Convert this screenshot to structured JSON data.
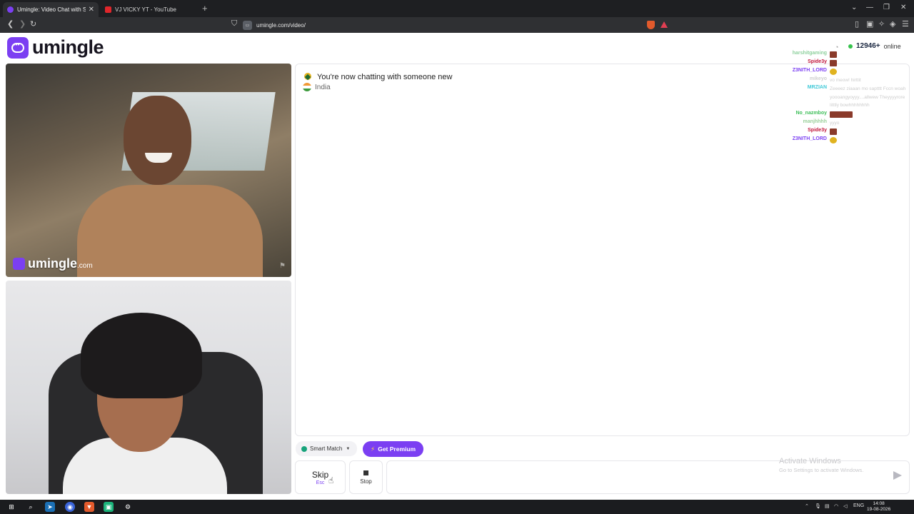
{
  "browser": {
    "tabs": [
      {
        "title": "Umingle: Video Chat with Str",
        "active": true,
        "favicon_color": "#7b3ff2"
      },
      {
        "title": "VJ VICKY YT - YouTube",
        "active": false,
        "favicon_color": "#ff0000"
      }
    ],
    "url": "umingle.com/video/"
  },
  "header": {
    "logo_text": "umingle",
    "online_count": "12946+",
    "online_label": "online"
  },
  "stranger_video": {
    "watermark_name": "umingle",
    "watermark_suffix": ".com"
  },
  "chat": {
    "status_message": "You're now chatting with someone new",
    "country": "India",
    "feed": [
      {
        "name": "harshitgaming",
        "color": "#8fd19e",
        "text": "",
        "thumb": "#8a3a2a"
      },
      {
        "name": "Spide3y",
        "color": "#c0153a",
        "text": "",
        "thumb": "#8a3a2a"
      },
      {
        "name": "Z3NITH_LORD",
        "color": "#7b3ff2",
        "text": "",
        "thumb": "#e0b320"
      },
      {
        "name": "mikeyo",
        "color": "#cfcfcf",
        "text": "vo meow! hirttit",
        "thumb": ""
      },
      {
        "name": "MRZIAN",
        "color": "#3fc9d8",
        "text": "Zeeeez ziaaan mo saptttt Fccn woah yoooangyoyyy....allwew Theyyyyrore litttly bowhhhhhhhh",
        "thumb": "",
        "tall": true
      },
      {
        "name": "No_nazmboy",
        "color": "#3fbf5a",
        "text": "",
        "thumb": "#8a3a2a",
        "wide": true
      },
      {
        "name": "manjhhhh",
        "color": "#9bd09b",
        "text": "yyyo",
        "thumb": ""
      },
      {
        "name": "Spide3y",
        "color": "#c0153a",
        "text": "",
        "thumb": "#8a3a2a"
      },
      {
        "name": "Z3NITH_LORD",
        "color": "#7b3ff2",
        "text": "",
        "thumb": "#e0b320"
      }
    ]
  },
  "controls": {
    "smart_match_label": "Smart Match",
    "premium_label": "Get Premium",
    "skip_label": "Skip",
    "skip_key": "Esc",
    "stop_label": "Stop",
    "message_placeholder": ""
  },
  "windows": {
    "activate_title": "Activate Windows",
    "activate_sub": "Go to Settings to activate Windows.",
    "lang": "ENG",
    "time": "14:08",
    "date": "19-08-2026"
  },
  "colors": {
    "brand": "#7b3ff2",
    "online_dot": "#35c24b"
  }
}
